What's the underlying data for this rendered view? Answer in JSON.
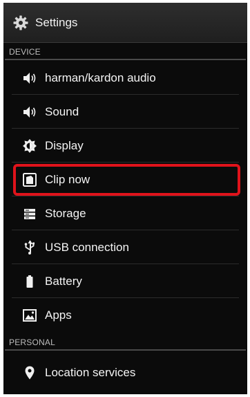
{
  "header": {
    "title": "Settings",
    "icon": "gear-icon"
  },
  "sections": [
    {
      "label": "DEVICE",
      "items": [
        {
          "label": "harman/kardon audio",
          "icon": "speaker-icon"
        },
        {
          "label": "Sound",
          "icon": "speaker-icon"
        },
        {
          "label": "Display",
          "icon": "brightness-icon"
        },
        {
          "label": "Clip now",
          "icon": "clip-icon",
          "highlighted": true
        },
        {
          "label": "Storage",
          "icon": "storage-icon"
        },
        {
          "label": "USB connection",
          "icon": "usb-icon"
        },
        {
          "label": "Battery",
          "icon": "battery-icon"
        },
        {
          "label": "Apps",
          "icon": "apps-icon"
        }
      ]
    },
    {
      "label": "PERSONAL",
      "items": [
        {
          "label": "Location services",
          "icon": "location-pin-icon"
        }
      ]
    }
  ],
  "colors": {
    "background": "#0b0b0b",
    "text": "#f4f4f4",
    "section_text": "#bdbdbd",
    "highlight_border": "#e0131b"
  }
}
